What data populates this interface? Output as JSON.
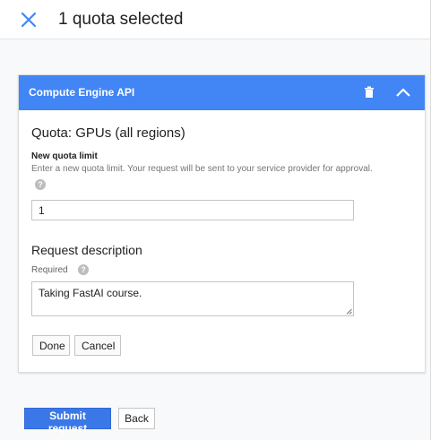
{
  "header": {
    "title": "1 quota selected",
    "close_icon": "close-icon"
  },
  "panel": {
    "title": "Compute Engine API",
    "delete_icon": "trash-icon",
    "collapse_icon": "chevron-up-icon",
    "accent_color": "#4285f4",
    "quota_name": "Quota: GPUs (all regions)",
    "new_limit": {
      "label": "New quota limit",
      "hint": "Enter a new quota limit. Your request will be sent to your service provider for approval.",
      "help_icon": "help-icon",
      "value": "1"
    },
    "description": {
      "heading": "Request description",
      "required_label": "Required",
      "help_icon": "help-icon",
      "value": "Taking FastAI course."
    },
    "done_label": "Done",
    "cancel_label": "Cancel"
  },
  "footer": {
    "submit_label": "Submit request",
    "back_label": "Back",
    "submit_color": "#3b78e7"
  }
}
